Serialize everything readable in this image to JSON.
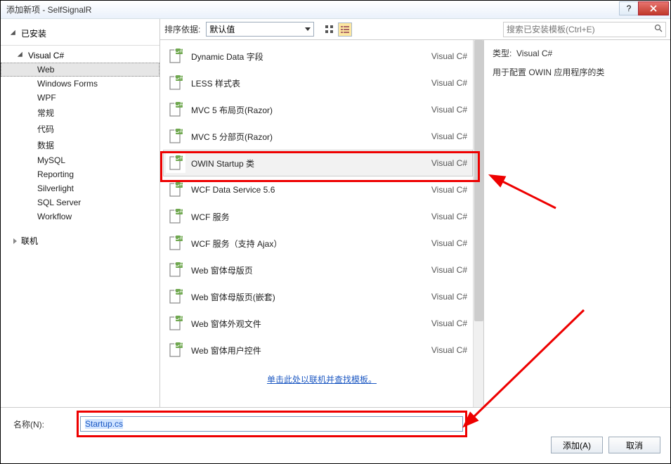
{
  "window": {
    "title": "添加新项 - SelfSignalR"
  },
  "sidebar": {
    "installed_label": "已安装",
    "lang_label": "Visual C#",
    "items": [
      "Web",
      "Windows Forms",
      "WPF",
      "常规",
      "代码",
      "数据",
      "MySQL",
      "Reporting",
      "Silverlight",
      "SQL Server",
      "Workflow"
    ],
    "online_label": "联机"
  },
  "topbar": {
    "sort_label": "排序依据:",
    "sort_value": "默认值",
    "search_placeholder": "搜索已安装模板(Ctrl+E)"
  },
  "templates": [
    {
      "name": "Dynamic Data 字段",
      "lang": "Visual C#",
      "sel": false
    },
    {
      "name": "LESS 样式表",
      "lang": "Visual C#",
      "sel": false
    },
    {
      "name": "MVC 5 布局页(Razor)",
      "lang": "Visual C#",
      "sel": false
    },
    {
      "name": "MVC 5 分部页(Razor)",
      "lang": "Visual C#",
      "sel": false
    },
    {
      "name": "OWIN Startup 类",
      "lang": "Visual C#",
      "sel": true
    },
    {
      "name": "WCF Data Service 5.6",
      "lang": "Visual C#",
      "sel": false
    },
    {
      "name": "WCF 服务",
      "lang": "Visual C#",
      "sel": false
    },
    {
      "name": "WCF 服务（支持 Ajax）",
      "lang": "Visual C#",
      "sel": false
    },
    {
      "name": "Web 窗体母版页",
      "lang": "Visual C#",
      "sel": false
    },
    {
      "name": "Web 窗体母版页(嵌套)",
      "lang": "Visual C#",
      "sel": false
    },
    {
      "name": "Web 窗体外观文件",
      "lang": "Visual C#",
      "sel": false
    },
    {
      "name": "Web 窗体用户控件",
      "lang": "Visual C#",
      "sel": false
    }
  ],
  "link_text": "单击此处以联机并查找模板。",
  "detail": {
    "type_label": "类型:",
    "type_value": "Visual C#",
    "desc": "用于配置 OWIN 应用程序的类"
  },
  "bottom": {
    "name_label": "名称(N):",
    "name_value": "Startup.cs",
    "add_label": "添加(A)",
    "cancel_label": "取消"
  }
}
